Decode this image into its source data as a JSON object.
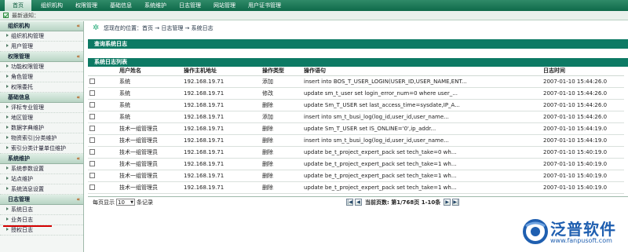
{
  "topnav": {
    "tabs": [
      {
        "label": "首页",
        "active": true
      },
      {
        "label": "组织机构"
      },
      {
        "label": "权限管理"
      },
      {
        "label": "基础信息"
      },
      {
        "label": "系统维护"
      },
      {
        "label": "日志管理"
      },
      {
        "label": "网站管理"
      },
      {
        "label": "用户证书管理"
      }
    ]
  },
  "notice": {
    "label": "最新通知："
  },
  "sidebar": {
    "groups": [
      {
        "title": "组织机构",
        "items": [
          "组织机构管理",
          "用户管理"
        ]
      },
      {
        "title": "权限管理",
        "items": [
          "功能权限管理",
          "角色管理",
          "权限委托"
        ]
      },
      {
        "title": "基础信息",
        "items": [
          "评标专业管理",
          "地区管理",
          "数据字典维护",
          "物资索引|分类维护",
          "索引分类计量单位维护"
        ]
      },
      {
        "title": "系统维护",
        "items": [
          "系统参数设置",
          "站点维护",
          "系统消息设置"
        ]
      },
      {
        "title": "日志管理",
        "items": [
          "系统日志",
          "业务日志",
          "授权日志"
        ]
      }
    ],
    "chevron": "«"
  },
  "breadcrumb": {
    "text": "您现在的位置：首页 → 日志管理 → 系统日志"
  },
  "query_bar": {
    "title": "查询系统日志"
  },
  "list_bar": {
    "title": "系统日志列表"
  },
  "table": {
    "headers": [
      "",
      "用户姓名",
      "操作主机地址",
      "操作类型",
      "操作语句",
      "日志时间"
    ],
    "rows": [
      [
        "系统",
        "192.168.19.71",
        "添加",
        "insert into BOS_T_USER_LOGIN(USER_ID,USER_NAME,ENT...",
        "2007-01-10 15:44:26.0"
      ],
      [
        "系统",
        "192.168.19.71",
        "修改",
        "update sm_t_user set login_error_num=0 where user_...",
        "2007-01-10 15:44:26.0"
      ],
      [
        "系统",
        "192.168.19.71",
        "删除",
        "update Sm_T_USER set last_access_time=sysdate,IP_A...",
        "2007-01-10 15:44:26.0"
      ],
      [
        "系统",
        "192.168.19.71",
        "添加",
        "insert into sm_t_busi_log(log_id,user_id,user_name...",
        "2007-01-10 15:44:26.0"
      ],
      [
        "技术一组管理员",
        "192.168.19.71",
        "删除",
        "update Sm_T_USER set IS_ONLINE='0',ip_addr...",
        "2007-01-10 15:44:19.0"
      ],
      [
        "技术一组管理员",
        "192.168.19.71",
        "删除",
        "insert into sm_t_busi_log(log_id,user_id,user_name...",
        "2007-01-10 15:44:19.0"
      ],
      [
        "技术一组管理员",
        "192.168.19.71",
        "删除",
        "update be_t_project_expert_pack set tech_take=0 wh...",
        "2007-01-10 15:40:19.0"
      ],
      [
        "技术一组管理员",
        "192.168.19.71",
        "删除",
        "update be_t_project_expert_pack set tech_take=1 wh...",
        "2007-01-10 15:40:19.0"
      ],
      [
        "技术一组管理员",
        "192.168.19.71",
        "删除",
        "update be_t_project_expert_pack set tech_take=1 wh...",
        "2007-01-10 15:40:19.0"
      ],
      [
        "技术一组管理员",
        "192.168.19.71",
        "删除",
        "update be_t_project_expert_pack set tech_take=1 wh...",
        "2007-01-10 15:40:19.0"
      ]
    ]
  },
  "pager": {
    "per_page_prefix": "每页显示",
    "per_page_value": "10",
    "per_page_suffix": "条记录",
    "page_info": "当前页数: 第1/768页 1-10条",
    "first": "|◀",
    "prev": "◀",
    "next": "▶",
    "last": "▶|"
  },
  "logo": {
    "text": "泛普软件",
    "url": "www.fanpusoft.com"
  },
  "colors": {
    "nav": "#0f6a4a",
    "bar": "#0d7a64",
    "logo": "#1f5fb0",
    "underline": "#d40000"
  }
}
